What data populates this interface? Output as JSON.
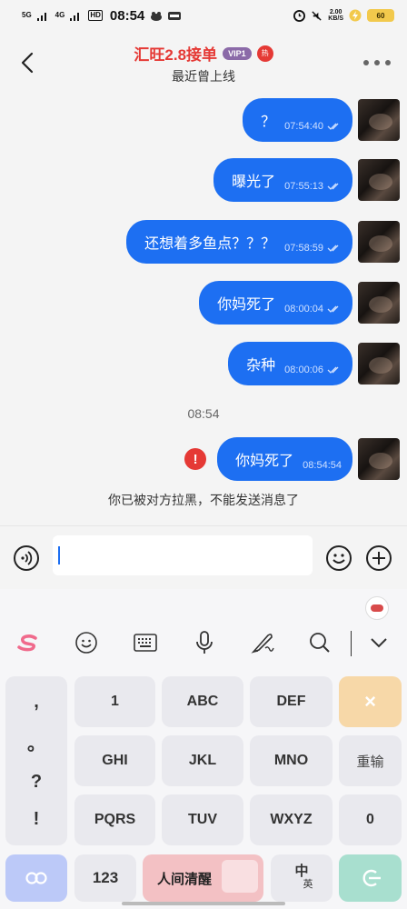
{
  "status_bar": {
    "network_1": "5G",
    "network_2": "4G",
    "hd_label": "HD",
    "time": "08:54",
    "speed_value": "2.00",
    "speed_unit": "KB/S",
    "battery": "60"
  },
  "header": {
    "title": "汇旺2.8接单",
    "vip_badge": "VIP1",
    "hot_badge": "热",
    "subtitle": "最近曾上线"
  },
  "messages": [
    {
      "text": "？",
      "time": "07:54:40",
      "status": "read"
    },
    {
      "text": "曝光了",
      "time": "07:55:13",
      "status": "read"
    },
    {
      "text": "还想着多鱼点？？？",
      "time": "07:58:59",
      "status": "read"
    },
    {
      "text": "你妈死了",
      "time": "08:00:04",
      "status": "read"
    },
    {
      "text": "杂种",
      "time": "08:00:06",
      "status": "read"
    }
  ],
  "time_divider": "08:54",
  "failed_message": {
    "text": "你妈死了",
    "time": "08:54:54",
    "error_mark": "!"
  },
  "blocked_notice": "你已被对方拉黑，不能发送消息了",
  "input": {
    "value": "",
    "placeholder": ""
  },
  "keyboard": {
    "toolbar_icons": [
      "sogou-logo-icon",
      "emoji-icon",
      "keyboard-icon",
      "microphone-icon",
      "handwriting-icon",
      "search-icon",
      "collapse-icon"
    ],
    "symbols": [
      ",",
      "。",
      "?",
      "!"
    ],
    "row1": [
      "1",
      "ABC",
      "DEF"
    ],
    "row2": [
      "GHI",
      "JKL",
      "MNO"
    ],
    "row3": [
      "PQRS",
      "TUV",
      "WXYZ"
    ],
    "delete": "×",
    "reset": "重输",
    "zero": "0",
    "numbers": "123",
    "space_label": "人间清醒",
    "cn_main": "中",
    "cn_sub": "英",
    "accent_colors": {
      "bubble": "#1d6ff2",
      "delete": "#f7d8a8",
      "space": "#f3c1c4",
      "enter": "#a8dfcf",
      "lang": "#bcc9f8"
    }
  }
}
